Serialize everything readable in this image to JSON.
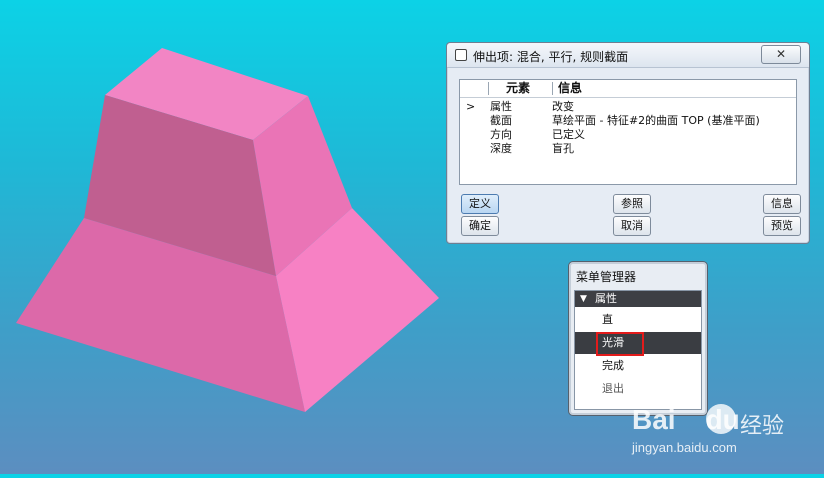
{
  "dialog": {
    "title": "伸出项: 混合, 平行, 规则截面",
    "close_label": "关闭",
    "columns": [
      "元素",
      "信息"
    ],
    "rows": [
      {
        "caret": ">",
        "name": "属性",
        "info": "改变"
      },
      {
        "caret": "",
        "name": "截面",
        "info": "草绘平面 - 特征#2的曲面 TOP  (基准平面)"
      },
      {
        "caret": "",
        "name": "方向",
        "info": "已定义"
      },
      {
        "caret": "",
        "name": "深度",
        "info": "盲孔"
      }
    ],
    "buttons": {
      "define": "定义",
      "refs": "参照",
      "info": "信息",
      "ok": "确定",
      "cancel": "取消",
      "preview": "预览"
    }
  },
  "menu_manager": {
    "title": "菜单管理器",
    "section": "属性",
    "items": [
      {
        "label": "直",
        "selected": false
      },
      {
        "label": "光滑",
        "selected": true
      },
      {
        "label": "完成",
        "selected": false
      },
      {
        "label": "退出",
        "selected": false
      }
    ]
  },
  "watermark": {
    "logo": "Bai",
    "logo2": "du",
    "right": "经验",
    "url": "jingyan.baidu.com"
  },
  "colors": {
    "background_top": "#0cd2e6",
    "background_bottom": "#5c8ec0",
    "model_pink": "#f070b8",
    "highlight_red": "#e31b1b",
    "menu_selected": "#3a3d42"
  }
}
